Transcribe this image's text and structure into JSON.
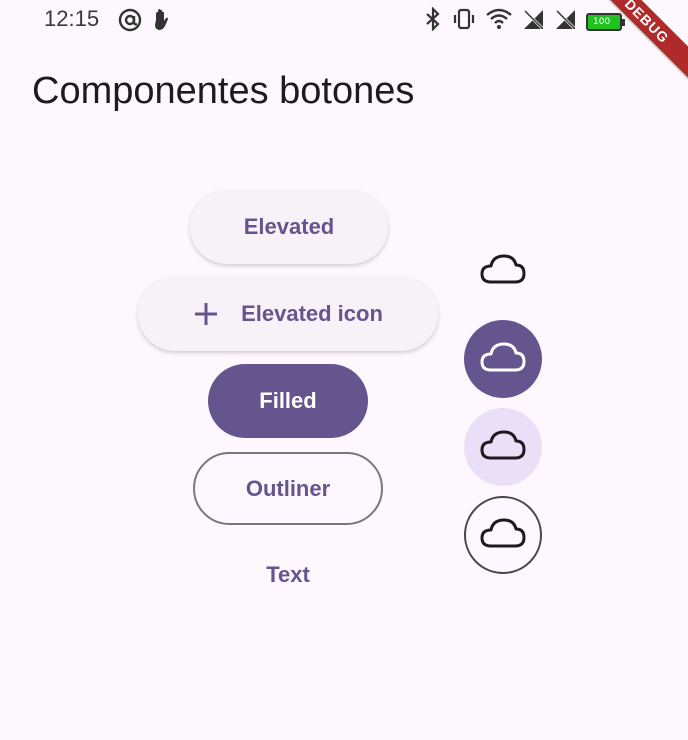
{
  "status_bar": {
    "time": "12:15",
    "left_icons": [
      "at-sign-icon",
      "hand-icon"
    ],
    "right_icons": [
      "bluetooth-icon",
      "vibrate-icon",
      "wifi-icon",
      "no-signal-icon",
      "no-signal-icon"
    ],
    "battery_icon": "battery-icon",
    "battery_level": "100",
    "debug_banner": "DEBUG"
  },
  "page": {
    "title": "Componentes botones"
  },
  "buttons": {
    "elevated": "Elevated",
    "elevated_icon": "Elevated icon",
    "elevated_icon_glyph": "add-icon",
    "filled": "Filled",
    "outlined": "Outliner",
    "text": "Text"
  },
  "icon_buttons": {
    "icon": "cloud-icon",
    "variants": [
      "standard",
      "filled",
      "tonal",
      "outlined"
    ]
  },
  "colors": {
    "primary": "#65558f",
    "background": "#fdf8fd",
    "tonal": "#e9e0f7",
    "surface": "#f7f2f7",
    "debug": "#b12a2a"
  }
}
